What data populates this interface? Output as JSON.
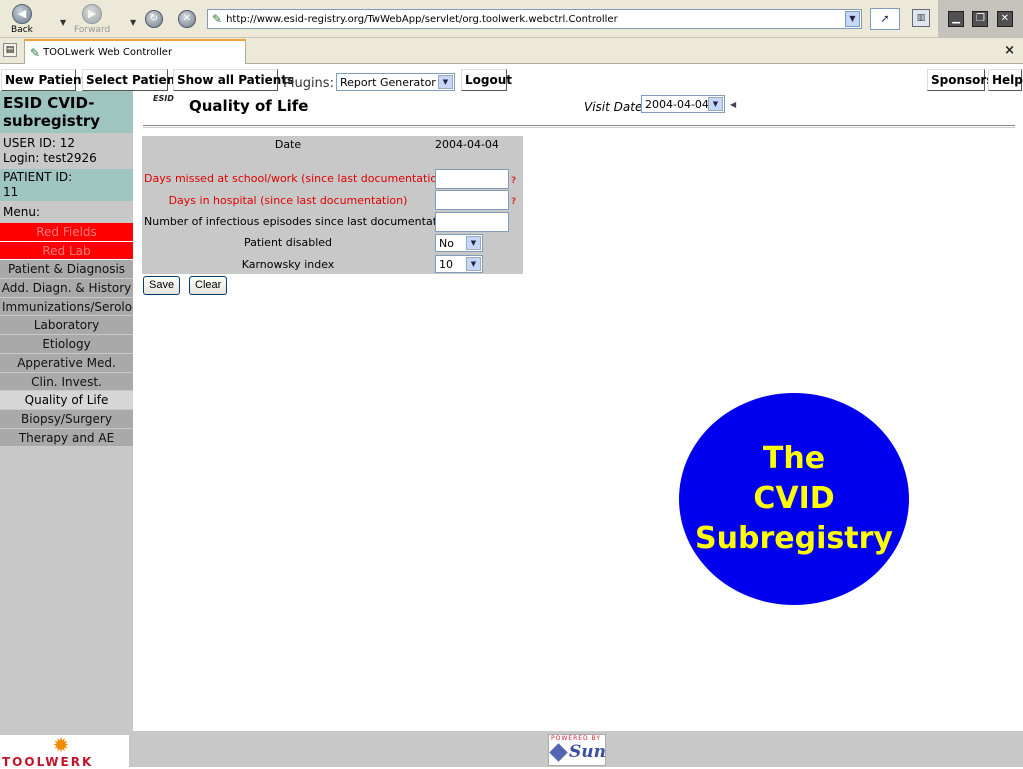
{
  "browser": {
    "back_label": "Back",
    "forward_label": "Forward",
    "url": "http://www.esid-registry.org/TwWebApp/servlet/org.toolwerk.webctrl.Controller",
    "tab_title": "TOOLwerk Web Controller"
  },
  "app_nav": {
    "new_patient": "New Patient",
    "select_patient": "Select Patient",
    "show_all_patients": "Show all Patients",
    "plugins_label": "Plugins:",
    "plugin_selected": "Report Generator",
    "logout": "Logout",
    "sponsors": "Sponsors",
    "help": "Help"
  },
  "sidebar": {
    "registry_title": "ESID CVID-subregistry",
    "user_id": "USER ID: 12",
    "login": "Login: test2926",
    "patient_id_label": "PATIENT ID:",
    "patient_id": "11",
    "menu_label": "Menu:",
    "menu_items": [
      {
        "label": "Red Fields",
        "style": "red"
      },
      {
        "label": "Red Lab",
        "style": "red"
      },
      {
        "label": "Patient & Diagnosis",
        "style": "grey"
      },
      {
        "label": "Add. Diagn. & History",
        "style": "grey"
      },
      {
        "label": "Immunizations/Serology",
        "style": "grey"
      },
      {
        "label": "Laboratory",
        "style": "grey"
      },
      {
        "label": "Etiology",
        "style": "grey"
      },
      {
        "label": "Apperative Med.",
        "style": "grey"
      },
      {
        "label": "Clin. Invest.",
        "style": "grey"
      },
      {
        "label": "Quality of Life",
        "style": "active"
      },
      {
        "label": "Biopsy/Surgery",
        "style": "grey"
      },
      {
        "label": "Therapy and AE",
        "style": "grey"
      }
    ]
  },
  "main": {
    "logo_text": "ESID",
    "page_title": "Quality of Life",
    "visit_date_label": "Visit Date:",
    "visit_date_value": "2004-04-04",
    "form": {
      "date_label": "Date",
      "date_value": "2004-04-04",
      "days_missed_label": "Days missed at school/work (since last documentation)",
      "days_hospital_label": "Days in hospital (since last documentation)",
      "infectious_label": "Number of infectious episodes since last documentation",
      "disabled_label": "Patient disabled",
      "disabled_value": "No",
      "karnowsky_label": "Karnowsky index",
      "karnowsky_value": "10",
      "save_label": "Save",
      "clear_label": "Clear"
    },
    "banner_text": "The\nCVID\nSubregistry"
  },
  "footer": {
    "toolwerk_text": "TOOLWERK",
    "sun_powered": "POWERED BY",
    "sun_text": "Sun"
  },
  "colors": {
    "sidebar_teal": "#9fc5c1",
    "menu_red": "#ff0000",
    "banner_blue": "#0000ee",
    "banner_text": "#ffff00"
  }
}
